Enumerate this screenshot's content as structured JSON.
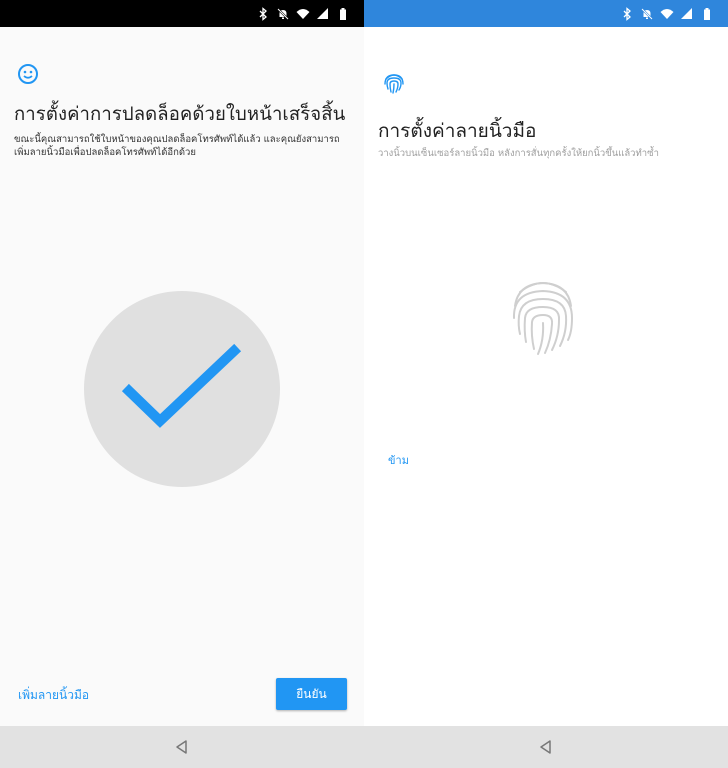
{
  "left": {
    "status_icons": [
      "bluetooth-icon",
      "bell-off-icon",
      "wifi-icon",
      "signal-icon",
      "battery-icon"
    ],
    "face_icon": "smiley-face-icon",
    "title": "การตั้งค่าการปลดล็อคด้วยใบหน้าเสร็จสิ้น",
    "description": "ขณะนี้คุณสามารถใช้ใบหน้าของคุณปลดล็อคโทรศัพท์ได้แล้ว และคุณยังสามารถเพิ่มลายนิ้วมือเพื่อปลดล็อคโทรศัพท์ได้อีกด้วย",
    "success_icon": "checkmark-icon",
    "add_fingerprint_label": "เพิ่มลายนิ้วมือ",
    "confirm_label": "ยืนยัน"
  },
  "right": {
    "status_icons": [
      "bluetooth-icon",
      "bell-off-icon",
      "wifi-icon",
      "signal-icon",
      "battery-icon"
    ],
    "fingerprint_icon": "fingerprint-icon",
    "title": "การตั้งค่าลายนิ้วมือ",
    "description": "วางนิ้วบนเซ็นเซอร์ลายนิ้วมือ หลังการสั่นทุกครั้งให้ยกนิ้วขึ้นแล้วทำซ้ำ",
    "skip_label": "ข้าม"
  },
  "nav": {
    "back_icon": "back-triangle-icon"
  },
  "colors": {
    "accent": "#2196f3",
    "status_blue": "#2f86dc",
    "status_dark": "#000000",
    "circle_grey": "#e0e0e0",
    "nav_grey": "#e2e2e2"
  }
}
